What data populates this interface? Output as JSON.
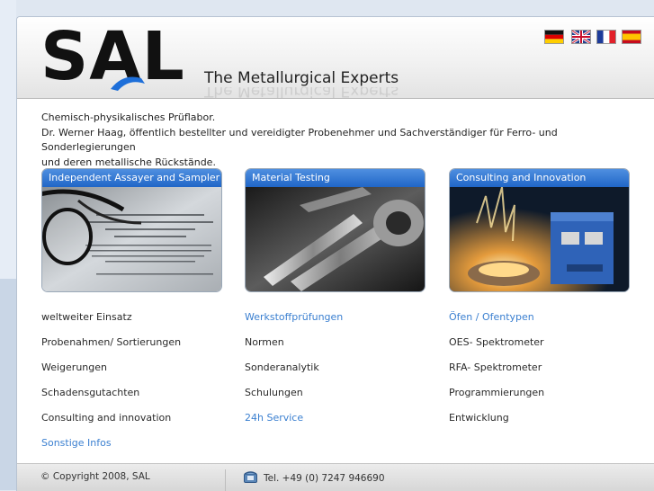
{
  "header": {
    "logo_text": "SAL",
    "tagline": "The Metallurgical Experts",
    "flags": [
      {
        "name": "german-flag-icon",
        "label": "Deutsch"
      },
      {
        "name": "uk-flag-icon",
        "label": "English"
      },
      {
        "name": "french-flag-icon",
        "label": "Français"
      },
      {
        "name": "spanish-flag-icon",
        "label": "Español"
      }
    ]
  },
  "intro": {
    "line1": "Chemisch-physikalisches Prüflabor.",
    "line2": "Dr. Werner Haag, öffentlich bestellter und vereidigter Probenehmer und Sachverständiger für Ferro- und Sonderlegierungen",
    "line3": "und deren metallische Rückstände."
  },
  "boxes": [
    {
      "title": "Independent Assayer and Sampler",
      "image": "certificate-with-glasses-image"
    },
    {
      "title": "Material Testing",
      "image": "drill-bits-image"
    },
    {
      "title": "Consulting and Innovation",
      "image": "melting-furnace-image"
    }
  ],
  "columns": [
    {
      "items": [
        {
          "label": "weltweiter Einsatz",
          "link": false
        },
        {
          "label": "Probenahmen/ Sortierungen",
          "link": false
        },
        {
          "label": "Weigerungen",
          "link": false
        },
        {
          "label": "Schadensgutachten",
          "link": false
        },
        {
          "label": "Consulting and innovation",
          "link": false
        },
        {
          "label": "Sonstige Infos",
          "link": true
        }
      ]
    },
    {
      "items": [
        {
          "label": "Werkstoffprüfungen",
          "link": true
        },
        {
          "label": "Normen",
          "link": false
        },
        {
          "label": "Sonderanalytik",
          "link": false
        },
        {
          "label": "Schulungen",
          "link": false
        },
        {
          "label": "24h Service",
          "link": true
        }
      ]
    },
    {
      "items": [
        {
          "label": "Öfen / Ofentypen",
          "link": true
        },
        {
          "label": "OES- Spektrometer",
          "link": false
        },
        {
          "label": "RFA- Spektrometer",
          "link": false
        },
        {
          "label": "Programmierungen",
          "link": false
        },
        {
          "label": "Entwicklung",
          "link": false
        }
      ]
    }
  ],
  "footer": {
    "copyright": "© Copyright 2008, SAL",
    "telephone": "Tel. +49 (0) 7247 946690"
  },
  "colors": {
    "accent_blue": "#2066c7",
    "link_blue": "#3a7fd0",
    "logo_arc": "#1e6fd9"
  }
}
